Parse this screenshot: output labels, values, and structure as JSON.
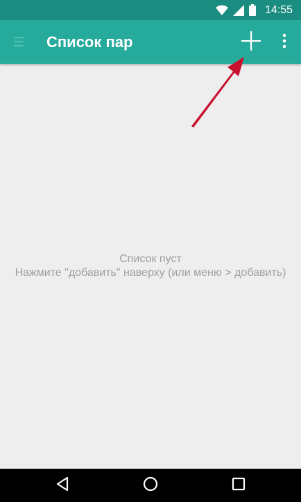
{
  "status_bar": {
    "time": "14:55",
    "icons": [
      "wifi-icon",
      "signal-icon",
      "battery-icon"
    ]
  },
  "toolbar": {
    "title": "Список пар",
    "actions": [
      "add-icon",
      "overflow-menu-icon"
    ],
    "icons": [
      "drawer-icon"
    ]
  },
  "empty_state": {
    "title": "Список пуст",
    "hint": "Нажмите \"добавить\" наверху (или меню > добавить)"
  },
  "nav_bar": {
    "icons": [
      "back-icon",
      "home-icon",
      "recents-icon"
    ]
  },
  "colors": {
    "status_bar": "#1a8c80",
    "toolbar": "#26aa9c",
    "background": "#eeeeee",
    "annotation": "#c8102e"
  }
}
